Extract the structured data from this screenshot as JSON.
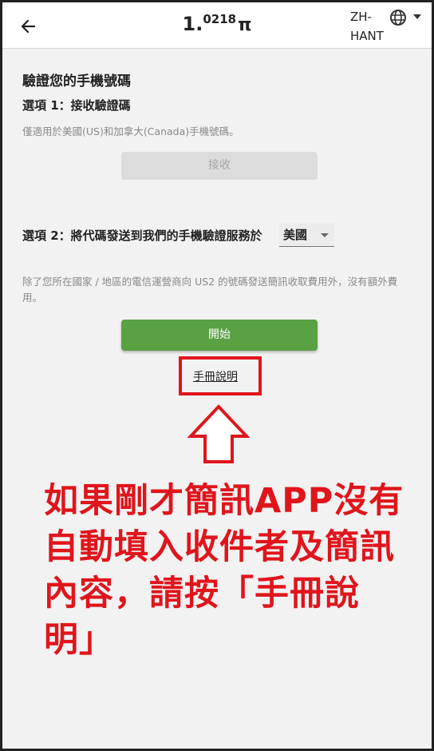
{
  "header": {
    "back_icon": "arrow-left-icon",
    "balance_int": "1.",
    "balance_frac": "0218",
    "balance_symbol": "π",
    "language": "ZH-HANT",
    "globe_icon": "globe-icon",
    "caret_icon": "caret-down-icon"
  },
  "main": {
    "title": "驗證您的手機號碼",
    "option1_label": "選項 1：接收驗證碼",
    "option1_note": "僅適用於美國(US)和加拿大(Canada)手機號碼。",
    "receive_button": "接收",
    "option2_label": "選項 2：將代碼發送到我們的手機驗證服務於",
    "country_value": "美國",
    "option2_note": "除了您所在國家 / 地區的電信運營商向 US2 的號碼發送簡訊收取費用外，沒有額外費用。",
    "start_button": "開始",
    "manual_link": "手冊說明"
  },
  "annotation": {
    "text": "如果剛才簡訊APP沒有自動填入收件者及簡訊內容，請按「手冊說明」",
    "color": "#e0151c"
  },
  "colors": {
    "accent_green": "#5aa144",
    "disabled_gray": "#dcdcdc",
    "highlight_red": "#e0151c"
  }
}
